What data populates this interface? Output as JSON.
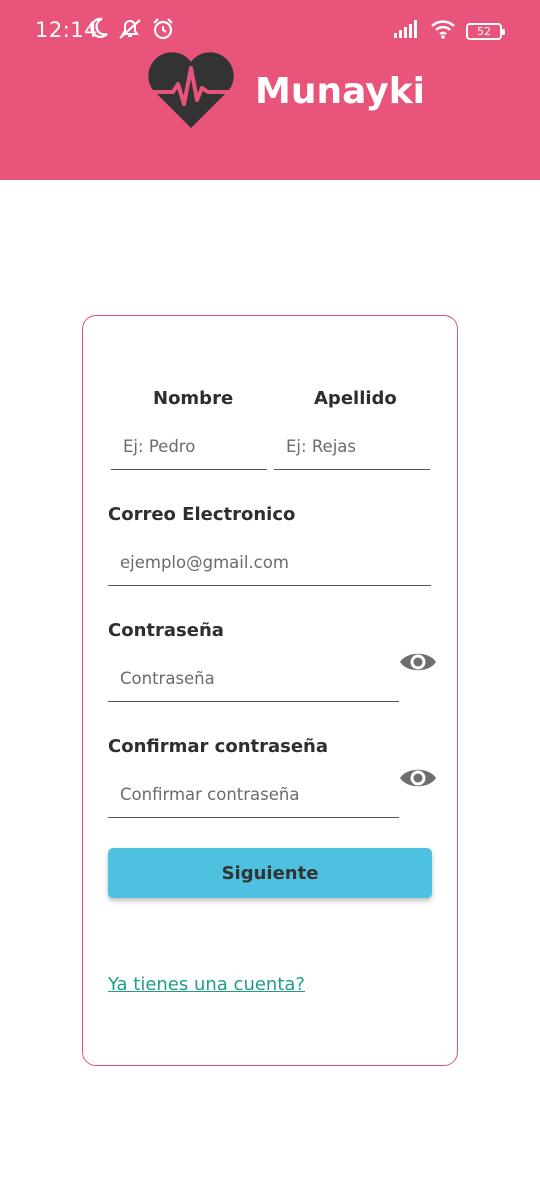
{
  "status_bar": {
    "time": "12:14",
    "battery": "52",
    "icons_left": [
      "moon-icon",
      "notifications-off-icon",
      "alarm-icon"
    ],
    "icons_right": [
      "signal-icon",
      "wifi-icon",
      "battery-icon"
    ]
  },
  "app": {
    "name": "Munayki",
    "logo_icon": "heart-pulse-icon",
    "header_color": "#e9547a"
  },
  "form": {
    "first_name": {
      "label": "Nombre",
      "placeholder": "Ej: Pedro",
      "value": ""
    },
    "last_name": {
      "label": "Apellido",
      "placeholder": "Ej: Rejas",
      "value": ""
    },
    "email": {
      "label": "Correo Electronico",
      "placeholder": "ejemplo@gmail.com",
      "value": ""
    },
    "password": {
      "label": "Contraseña",
      "placeholder": "Contraseña",
      "value": "",
      "toggle_icon": "eye-icon"
    },
    "confirm_password": {
      "label": "Confirmar contraseña",
      "placeholder": "Confirmar contraseña",
      "value": "",
      "toggle_icon": "eye-icon"
    },
    "submit_label": "Siguiente",
    "submit_color": "#4ec0e0",
    "login_link": "Ya tienes una cuenta?",
    "link_color": "#1f9e86"
  }
}
